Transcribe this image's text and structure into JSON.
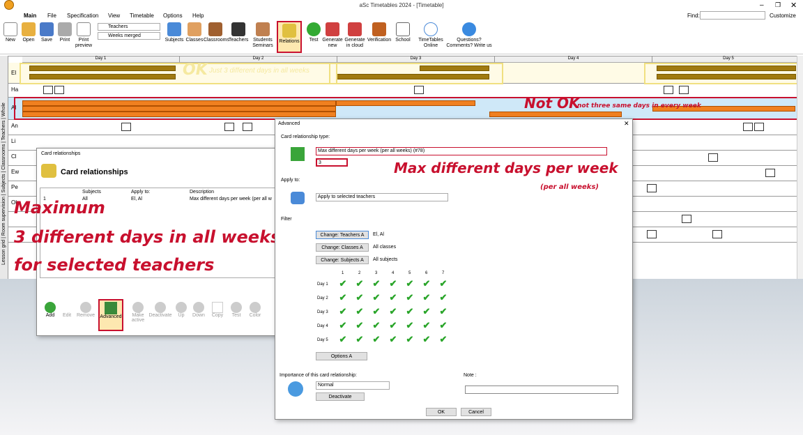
{
  "window": {
    "title": "aSc Timetables 2024 - [Timetable]",
    "find_label": "Find:",
    "customize": "Customize"
  },
  "menu": [
    "Main",
    "File",
    "Specification",
    "View",
    "Timetable",
    "Options",
    "Help"
  ],
  "ribbon": {
    "new": "New",
    "open": "Open",
    "save": "Save",
    "print": "Print",
    "print_preview": "Print preview",
    "view_select": "Teachers",
    "weeks_select": "Weeks merged",
    "subjects": "Subjects",
    "classes": "Classes",
    "classrooms": "Classrooms",
    "teachers": "Teachers",
    "students": "Students",
    "seminars": "Seminars",
    "relations": "Relations",
    "test": "Test",
    "generate_new": "Generate new",
    "generate_cloud": "Generate in cloud",
    "verification": "Verification",
    "school": "School",
    "online": "TimeTables Online",
    "questions": "Questions? Comments? Write us"
  },
  "vertical_tabs": [
    "Lesson grid",
    "Room supervision",
    "Subjects",
    "Classrooms",
    "Teachers",
    "Whole"
  ],
  "grid": {
    "days": [
      "Day 1",
      "Day 2",
      "Day 3",
      "Day 4",
      "Day 5"
    ],
    "rows": [
      "El",
      "Ha",
      "Al",
      "An",
      "Li",
      "Cl",
      "Ew",
      "Pe",
      "Ol"
    ]
  },
  "annotations": {
    "ok": "OK",
    "ok_note": "Just 3 different days in all weeks",
    "notok": "Not OK",
    "notok_note": "not three same days in every week",
    "max_title": "Max different days per week",
    "max_sub": "(per all weeks)",
    "left1": "Maximum",
    "left2": "3 different days in all weeks",
    "left3": "for selected teachers"
  },
  "cr_dialog": {
    "title": "Card relationships",
    "heading": "Card relationships",
    "cols": [
      "Subjects",
      "Apply to:",
      "Description"
    ],
    "row": {
      "num": "1",
      "subjects": "All",
      "apply": "El, Al",
      "desc": "Max different days per week (per all w"
    },
    "tools": [
      "Add",
      "Edit",
      "Remove",
      "Advanced",
      "Make active",
      "Deactivate",
      "Up",
      "Down",
      "Copy",
      "Test",
      "Color"
    ]
  },
  "adv": {
    "title": "Advanced",
    "type_label": "Card relationship type:",
    "type_value": "Max different days per week (per all weeks) (#78)",
    "number": "3",
    "apply_label": "Apply to:",
    "apply_value": "Apply to selected teachers",
    "filter_label": "Filter",
    "change_teachers": "Change: Teachers A",
    "teachers_val": "El, Al",
    "change_classes": "Change: Classes A",
    "classes_val": "All classes",
    "change_subjects": "Change: Subjects A",
    "subjects_val": "All subjects",
    "periods": [
      "1",
      "2",
      "3",
      "4",
      "5",
      "6",
      "7"
    ],
    "days": [
      "Day 1",
      "Day 2",
      "Day 3",
      "Day 4",
      "Day 5"
    ],
    "options": "Options A",
    "importance_label": "Importance of this card relationship:",
    "importance_value": "Normal",
    "deactivate": "Deactivate",
    "note_label": "Note :",
    "ok": "OK",
    "cancel": "Cancel"
  }
}
